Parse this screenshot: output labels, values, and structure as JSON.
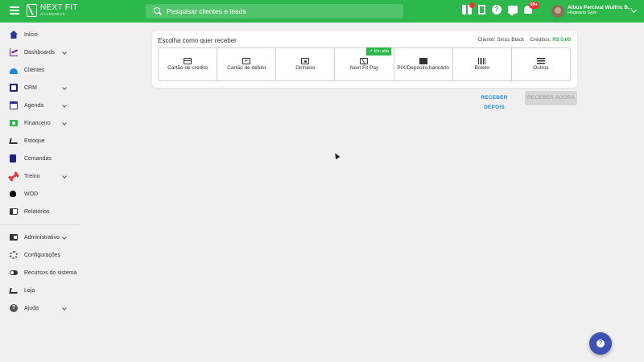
{
  "topbar": {
    "brand_title": "NEXT FIT",
    "brand_sub": "ACADEMIAS",
    "search_placeholder": "Pesquisar clientes e leads",
    "notification_count": "99+",
    "user_name": "Albus Percival Wulfric B...",
    "user_gym": "Hogwarts Gym",
    "accent_color": "#2db84b",
    "icons": [
      "menu-icon",
      "gift-icon",
      "door-icon",
      "help-icon",
      "chat-icon",
      "bell-icon"
    ]
  },
  "sidebar": {
    "items": [
      {
        "label": "Início",
        "icon": "home-icon"
      },
      {
        "label": "Dashboards",
        "icon": "chart-icon",
        "expandable": true
      },
      {
        "label": "Clientes",
        "icon": "people-icon"
      },
      {
        "label": "CRM",
        "icon": "crm-icon",
        "expandable": true
      },
      {
        "label": "Agenda",
        "icon": "calendar-icon",
        "expandable": true
      },
      {
        "label": "Financeiro",
        "icon": "money-icon",
        "expandable": true
      },
      {
        "label": "Estoque",
        "icon": "cart-icon"
      },
      {
        "label": "Comandas",
        "icon": "book-icon"
      },
      {
        "label": "Treino",
        "icon": "dumbbell-icon",
        "expandable": true
      },
      {
        "label": "WOD",
        "icon": "kettlebell-icon"
      },
      {
        "label": "Relatórios",
        "icon": "report-icon"
      },
      {
        "label": "Administrativo",
        "icon": "id-card-icon",
        "expandable": true
      },
      {
        "label": "Configurações",
        "icon": "gear-icon"
      },
      {
        "label": "Recursos do sistema",
        "icon": "toggle-icon"
      },
      {
        "label": "Loja",
        "icon": "cart-icon"
      },
      {
        "label": "Ajuda",
        "icon": "help-icon",
        "expandable": true
      }
    ]
  },
  "payment": {
    "title": "Escolha como quer receber",
    "client_label": "Cliente:",
    "client_name": "Sirius Black",
    "credits_label": "Créditos:",
    "credits_value": "R$ 0,00",
    "hot_tag": "Em alta",
    "methods": [
      {
        "label": "Cartão de crédito",
        "icon": "credit-card-icon"
      },
      {
        "label": "Cartão de débito",
        "icon": "debit-card-icon"
      },
      {
        "label": "Dinheiro",
        "icon": "cash-icon"
      },
      {
        "label": "Next Fit Pay",
        "icon": "nextfit-pay-icon"
      },
      {
        "label": "PIX/Depósito bancário",
        "icon": "pix-icon"
      },
      {
        "label": "Boleto",
        "icon": "barcode-icon"
      },
      {
        "label": "Outros",
        "icon": "list-icon"
      }
    ],
    "receive_later": "RECEBER DEPOIS",
    "receive_now": "RECEBER AGORA"
  },
  "fab": {
    "icon": "help-icon",
    "color": "#3f51b5"
  }
}
